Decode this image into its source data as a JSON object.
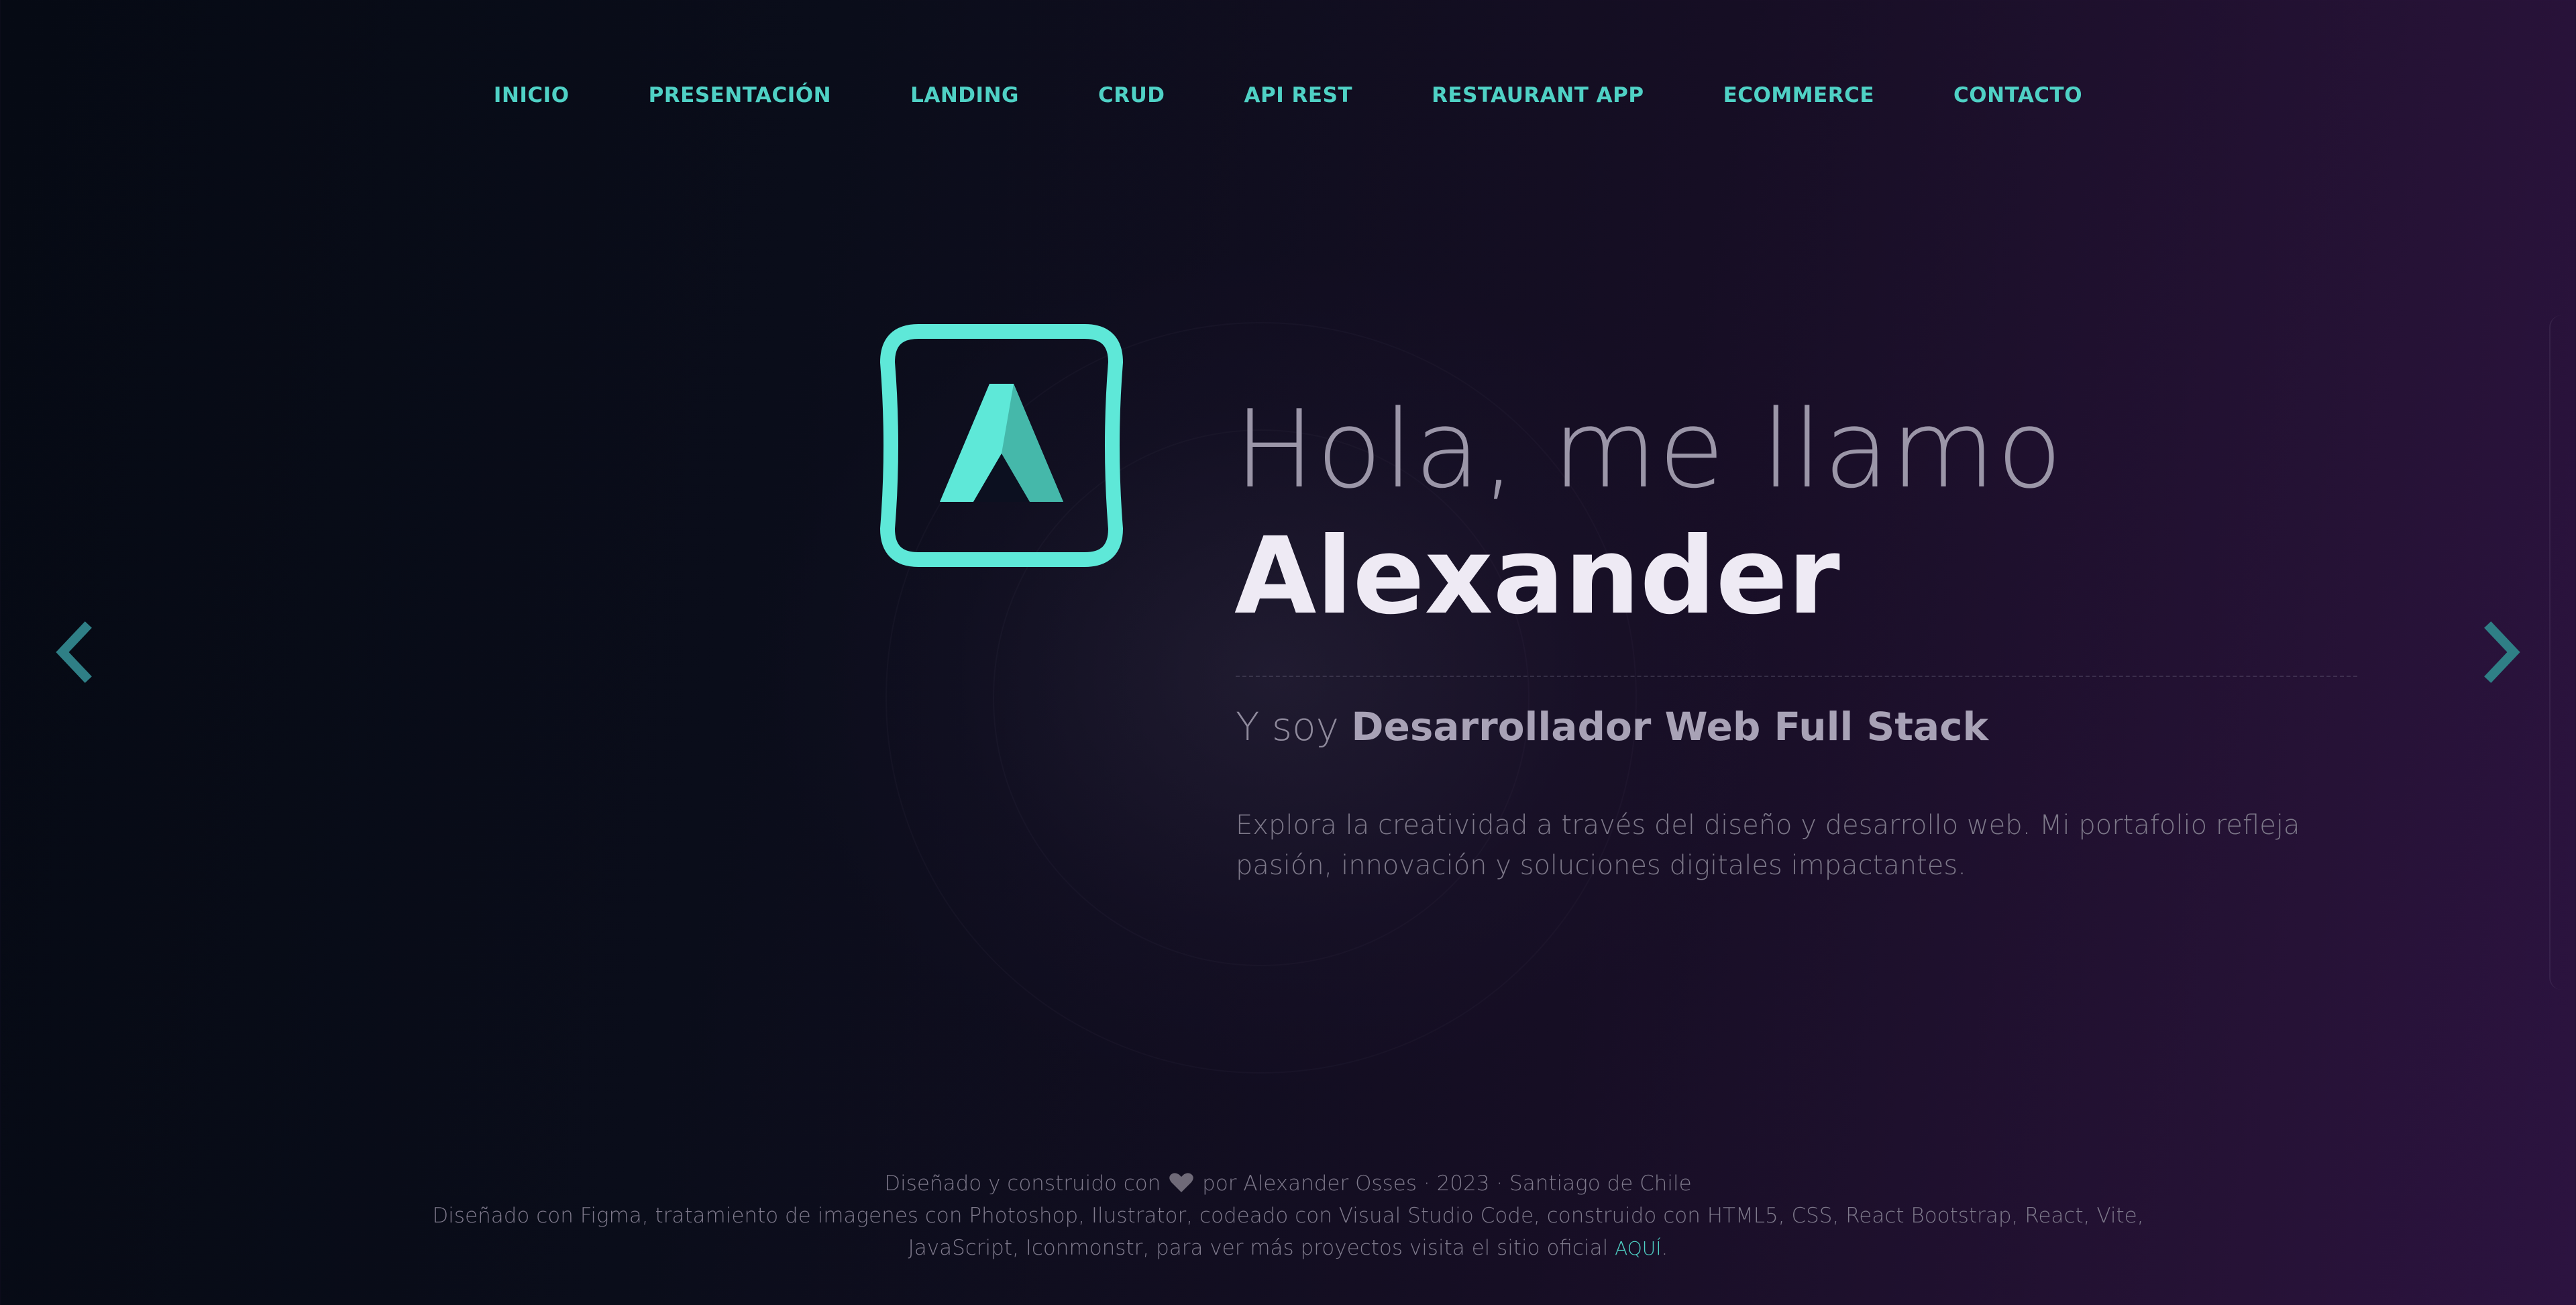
{
  "nav": {
    "items": [
      {
        "label": "INICIO"
      },
      {
        "label": "PRESENTACIÓN"
      },
      {
        "label": "LANDING"
      },
      {
        "label": "CRUD"
      },
      {
        "label": "API REST"
      },
      {
        "label": "RESTAURANT APP"
      },
      {
        "label": "ECOMMERCE"
      },
      {
        "label": "CONTACTO"
      }
    ]
  },
  "hero": {
    "greeting": "Hola, me llamo",
    "name": "Alexander",
    "role_prefix": "Y soy ",
    "role": "Desarrollador Web Full Stack",
    "description": "Explora la creatividad a través del diseño y desarrollo web. Mi portafolio refleja pasión, innovación y soluciones digitales impactantes.",
    "logo_letter": "A"
  },
  "carousel": {
    "prev_icon": "chevron-left-icon",
    "next_icon": "chevron-right-icon"
  },
  "footer": {
    "line1_before": "Diseñado y construido con",
    "line1_after": "por Alexander Osses · 2023 · Santiago de Chile",
    "heart_icon": "heart-icon",
    "line2": "Diseñado con Figma, tratamiento de imagenes con Photoshop, Ilustrator, codeado con Visual Studio Code, construido con HTML5, CSS, React Bootstrap, React, Vite,",
    "line3_before": "JavaScript, Iconmonstr, para ver más proyectos visita el sitio oficial",
    "link_label": "AQUÍ",
    "line3_after": "."
  },
  "colors": {
    "accent": "#4fd1c5",
    "logo": "#5ee8d8",
    "background_left": "#060a14",
    "background_right": "#2c1340"
  }
}
